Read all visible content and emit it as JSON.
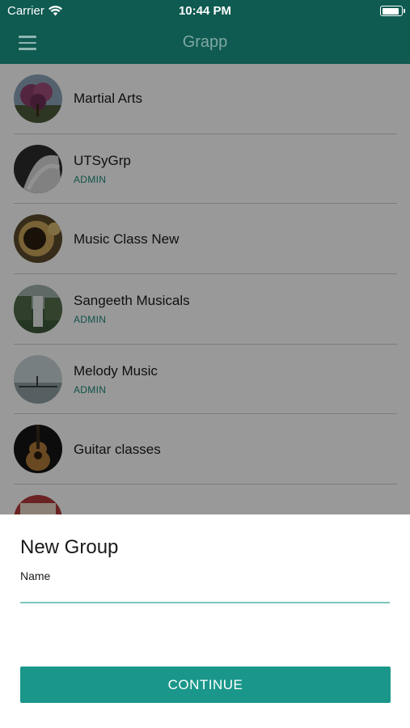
{
  "status_bar": {
    "carrier": "Carrier",
    "time": "10:44 PM"
  },
  "nav": {
    "title": "Grapp"
  },
  "groups": [
    {
      "name": "Martial Arts",
      "role": ""
    },
    {
      "name": "UTSyGrp",
      "role": "ADMIN"
    },
    {
      "name": "Music Class New",
      "role": ""
    },
    {
      "name": "Sangeeth Musicals",
      "role": "ADMIN"
    },
    {
      "name": "Melody Music",
      "role": "ADMIN"
    },
    {
      "name": "Guitar classes",
      "role": ""
    },
    {
      "name": "",
      "role": ""
    }
  ],
  "sheet": {
    "title": "New Group",
    "name_label": "Name",
    "name_value": "",
    "continue_label": "CONTINUE"
  },
  "colors": {
    "header": "#0f5a51",
    "accent": "#1a978a",
    "role_text": "#1b8a7b"
  }
}
